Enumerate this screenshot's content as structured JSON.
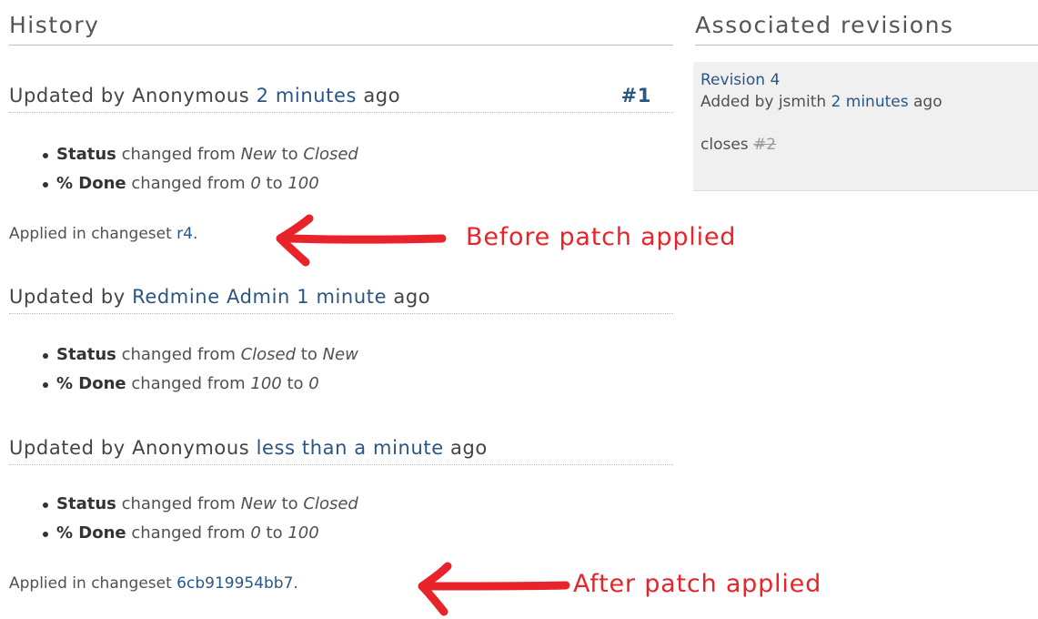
{
  "history": {
    "title": "History",
    "journals": [
      {
        "updated_prefix": "Updated by ",
        "author": "Anonymous",
        "time": "2 minutes",
        "ago": " ago",
        "number": "#1",
        "details": [
          {
            "field": "Status",
            "changed_from": " changed from ",
            "old": "New",
            "to": " to ",
            "new": "Closed"
          },
          {
            "field": "% Done",
            "changed_from": " changed from ",
            "old": "0",
            "to": " to ",
            "new": "100"
          }
        ],
        "note_prefix": "Applied in changeset ",
        "note_link": "r4",
        "note_suffix": "."
      },
      {
        "updated_prefix": "Updated by ",
        "author": "Redmine Admin",
        "time": "1 minute",
        "ago": " ago",
        "details": [
          {
            "field": "Status",
            "changed_from": " changed from ",
            "old": "Closed",
            "to": " to ",
            "new": "New"
          },
          {
            "field": "% Done",
            "changed_from": " changed from ",
            "old": "100",
            "to": " to ",
            "new": "0"
          }
        ]
      },
      {
        "updated_prefix": "Updated by ",
        "author": "Anonymous",
        "time": "less than a minute",
        "ago": " ago",
        "details": [
          {
            "field": "Status",
            "changed_from": " changed from ",
            "old": "New",
            "to": " to ",
            "new": "Closed"
          },
          {
            "field": "% Done",
            "changed_from": " changed from ",
            "old": "0",
            "to": " to ",
            "new": "100"
          }
        ],
        "note_prefix": "Applied in changeset ",
        "note_link": "6cb919954bb7",
        "note_suffix": "."
      }
    ]
  },
  "associated_revisions": {
    "title": "Associated revisions",
    "revision_link": "Revision 4",
    "added_by_prefix": "Added by ",
    "author": "jsmith",
    "time": "2 minutes",
    "ago": " ago",
    "comment_prefix": "closes ",
    "issue_link": "#2"
  },
  "annotations": {
    "before": "Before patch applied",
    "after": "After patch applied",
    "color": "#e8232a"
  },
  "colors": {
    "link": "#2a5685",
    "text": "#505050",
    "changeset_bg": "#f0f0f0"
  }
}
